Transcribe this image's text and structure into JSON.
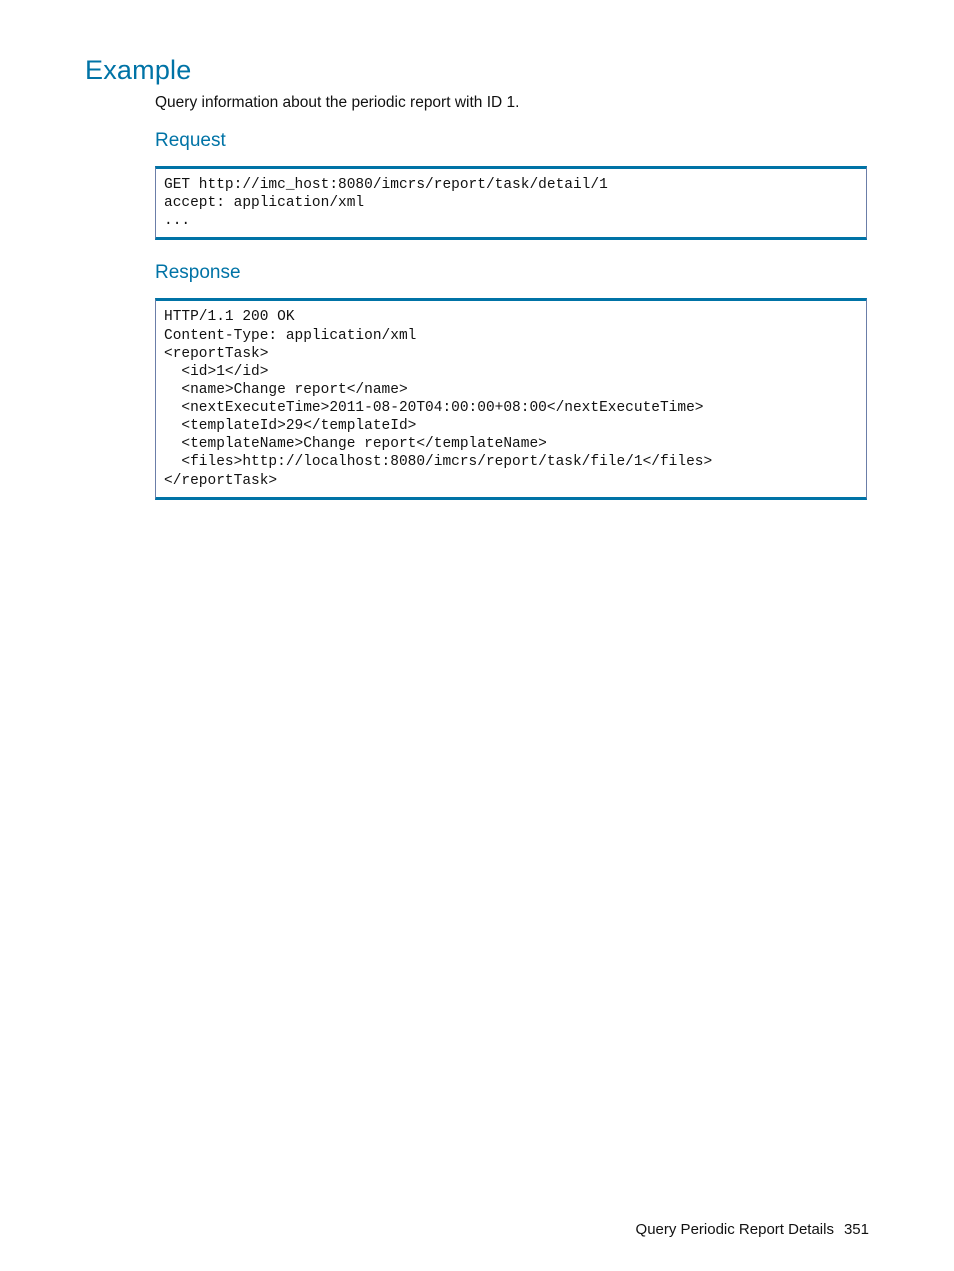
{
  "headings": {
    "example": "Example",
    "request": "Request",
    "response": "Response"
  },
  "intro_text": "Query information about the periodic report with ID 1.",
  "request_code": "GET http://imc_host:8080/imcrs/report/task/detail/1\naccept: application/xml\n...",
  "response_code": "HTTP/1.1 200 OK\nContent-Type: application/xml\n<reportTask>\n  <id>1</id>\n  <name>Change report</name>\n  <nextExecuteTime>2011-08-20T04:00:00+08:00</nextExecuteTime>\n  <templateId>29</templateId>\n  <templateName>Change report</templateName>\n  <files>http://localhost:8080/imcrs/report/task/file/1</files>\n</reportTask>",
  "footer": {
    "title": "Query Periodic Report Details",
    "page": "351"
  }
}
